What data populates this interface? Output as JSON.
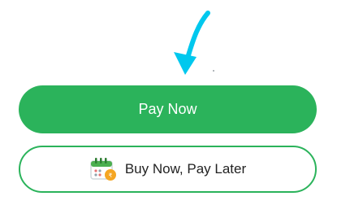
{
  "pay_now": {
    "label": "Pay Now"
  },
  "bnpl": {
    "label": "Buy Now, Pay Later",
    "icon": "calendar-pay-icon"
  },
  "pointer": {
    "icon": "curved-arrow-down-icon",
    "color": "#00c8ee"
  },
  "colors": {
    "brand_green": "#2bb35b"
  }
}
